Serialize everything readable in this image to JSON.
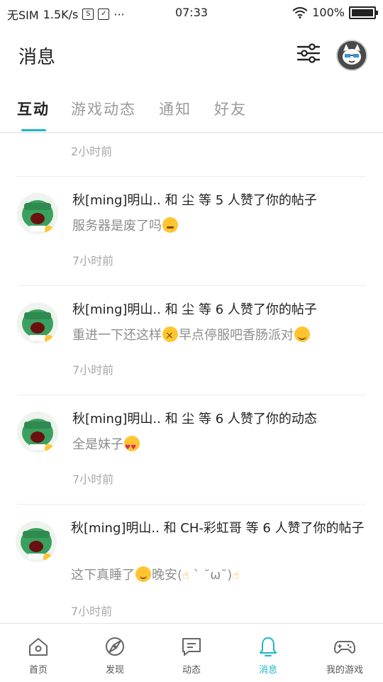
{
  "status_bar": {
    "carrier": "无SIM",
    "speed": "1.5K/s",
    "time": "07:33",
    "battery": "100%",
    "more": "···"
  },
  "header": {
    "title": "消息"
  },
  "tabs": [
    {
      "label": "互动",
      "active": true
    },
    {
      "label": "游戏动态",
      "active": false
    },
    {
      "label": "通知",
      "active": false
    },
    {
      "label": "好友",
      "active": false
    }
  ],
  "list": {
    "top_time": "2小时前",
    "items": [
      {
        "line1": "秋[ming]明山.. 和 尘 等 5 人赞了你的帖子",
        "line2": "服务器是废了吗",
        "time": "7小时前"
      },
      {
        "line1": "秋[ming]明山.. 和 尘 等 6 人赞了你的帖子",
        "line2_a": "重进一下还这样",
        "line2_b": "早点停服吧香肠派对",
        "time": "7小时前"
      },
      {
        "line1": "秋[ming]明山.. 和 尘 等 6 人赞了你的动态",
        "line2": "全是妹子",
        "time": "7小时前"
      },
      {
        "line1": "秋[ming]明山.. 和 CH-彩虹哥 等 6 人赞了你的帖子",
        "line2_a": "这下真睡了",
        "line2_b": "晚安(",
        "line2_c": " ` ˘ω˘)",
        "time": "7小时前"
      }
    ]
  },
  "bottom_nav": [
    {
      "label": "首页",
      "icon": "home-icon",
      "active": false
    },
    {
      "label": "发现",
      "icon": "discover-icon",
      "active": false
    },
    {
      "label": "动态",
      "icon": "feed-icon",
      "active": false
    },
    {
      "label": "消息",
      "icon": "bell-icon",
      "active": true
    },
    {
      "label": "我的游戏",
      "icon": "gamepad-icon",
      "active": false
    }
  ],
  "colors": {
    "accent": "#1bb6c8",
    "muted": "#9a9a9a"
  }
}
